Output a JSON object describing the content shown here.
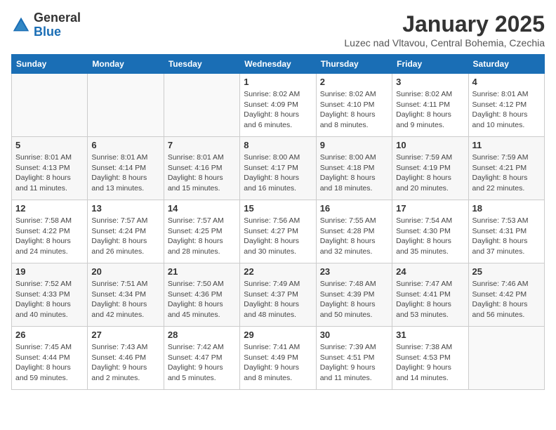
{
  "header": {
    "logo_general": "General",
    "logo_blue": "Blue",
    "month_title": "January 2025",
    "subtitle": "Luzec nad Vltavou, Central Bohemia, Czechia"
  },
  "days_of_week": [
    "Sunday",
    "Monday",
    "Tuesday",
    "Wednesday",
    "Thursday",
    "Friday",
    "Saturday"
  ],
  "weeks": [
    [
      {
        "day": "",
        "info": ""
      },
      {
        "day": "",
        "info": ""
      },
      {
        "day": "",
        "info": ""
      },
      {
        "day": "1",
        "info": "Sunrise: 8:02 AM\nSunset: 4:09 PM\nDaylight: 8 hours and 6 minutes."
      },
      {
        "day": "2",
        "info": "Sunrise: 8:02 AM\nSunset: 4:10 PM\nDaylight: 8 hours and 8 minutes."
      },
      {
        "day": "3",
        "info": "Sunrise: 8:02 AM\nSunset: 4:11 PM\nDaylight: 8 hours and 9 minutes."
      },
      {
        "day": "4",
        "info": "Sunrise: 8:01 AM\nSunset: 4:12 PM\nDaylight: 8 hours and 10 minutes."
      }
    ],
    [
      {
        "day": "5",
        "info": "Sunrise: 8:01 AM\nSunset: 4:13 PM\nDaylight: 8 hours and 11 minutes."
      },
      {
        "day": "6",
        "info": "Sunrise: 8:01 AM\nSunset: 4:14 PM\nDaylight: 8 hours and 13 minutes."
      },
      {
        "day": "7",
        "info": "Sunrise: 8:01 AM\nSunset: 4:16 PM\nDaylight: 8 hours and 15 minutes."
      },
      {
        "day": "8",
        "info": "Sunrise: 8:00 AM\nSunset: 4:17 PM\nDaylight: 8 hours and 16 minutes."
      },
      {
        "day": "9",
        "info": "Sunrise: 8:00 AM\nSunset: 4:18 PM\nDaylight: 8 hours and 18 minutes."
      },
      {
        "day": "10",
        "info": "Sunrise: 7:59 AM\nSunset: 4:19 PM\nDaylight: 8 hours and 20 minutes."
      },
      {
        "day": "11",
        "info": "Sunrise: 7:59 AM\nSunset: 4:21 PM\nDaylight: 8 hours and 22 minutes."
      }
    ],
    [
      {
        "day": "12",
        "info": "Sunrise: 7:58 AM\nSunset: 4:22 PM\nDaylight: 8 hours and 24 minutes."
      },
      {
        "day": "13",
        "info": "Sunrise: 7:57 AM\nSunset: 4:24 PM\nDaylight: 8 hours and 26 minutes."
      },
      {
        "day": "14",
        "info": "Sunrise: 7:57 AM\nSunset: 4:25 PM\nDaylight: 8 hours and 28 minutes."
      },
      {
        "day": "15",
        "info": "Sunrise: 7:56 AM\nSunset: 4:27 PM\nDaylight: 8 hours and 30 minutes."
      },
      {
        "day": "16",
        "info": "Sunrise: 7:55 AM\nSunset: 4:28 PM\nDaylight: 8 hours and 32 minutes."
      },
      {
        "day": "17",
        "info": "Sunrise: 7:54 AM\nSunset: 4:30 PM\nDaylight: 8 hours and 35 minutes."
      },
      {
        "day": "18",
        "info": "Sunrise: 7:53 AM\nSunset: 4:31 PM\nDaylight: 8 hours and 37 minutes."
      }
    ],
    [
      {
        "day": "19",
        "info": "Sunrise: 7:52 AM\nSunset: 4:33 PM\nDaylight: 8 hours and 40 minutes."
      },
      {
        "day": "20",
        "info": "Sunrise: 7:51 AM\nSunset: 4:34 PM\nDaylight: 8 hours and 42 minutes."
      },
      {
        "day": "21",
        "info": "Sunrise: 7:50 AM\nSunset: 4:36 PM\nDaylight: 8 hours and 45 minutes."
      },
      {
        "day": "22",
        "info": "Sunrise: 7:49 AM\nSunset: 4:37 PM\nDaylight: 8 hours and 48 minutes."
      },
      {
        "day": "23",
        "info": "Sunrise: 7:48 AM\nSunset: 4:39 PM\nDaylight: 8 hours and 50 minutes."
      },
      {
        "day": "24",
        "info": "Sunrise: 7:47 AM\nSunset: 4:41 PM\nDaylight: 8 hours and 53 minutes."
      },
      {
        "day": "25",
        "info": "Sunrise: 7:46 AM\nSunset: 4:42 PM\nDaylight: 8 hours and 56 minutes."
      }
    ],
    [
      {
        "day": "26",
        "info": "Sunrise: 7:45 AM\nSunset: 4:44 PM\nDaylight: 8 hours and 59 minutes."
      },
      {
        "day": "27",
        "info": "Sunrise: 7:43 AM\nSunset: 4:46 PM\nDaylight: 9 hours and 2 minutes."
      },
      {
        "day": "28",
        "info": "Sunrise: 7:42 AM\nSunset: 4:47 PM\nDaylight: 9 hours and 5 minutes."
      },
      {
        "day": "29",
        "info": "Sunrise: 7:41 AM\nSunset: 4:49 PM\nDaylight: 9 hours and 8 minutes."
      },
      {
        "day": "30",
        "info": "Sunrise: 7:39 AM\nSunset: 4:51 PM\nDaylight: 9 hours and 11 minutes."
      },
      {
        "day": "31",
        "info": "Sunrise: 7:38 AM\nSunset: 4:53 PM\nDaylight: 9 hours and 14 minutes."
      },
      {
        "day": "",
        "info": ""
      }
    ]
  ]
}
